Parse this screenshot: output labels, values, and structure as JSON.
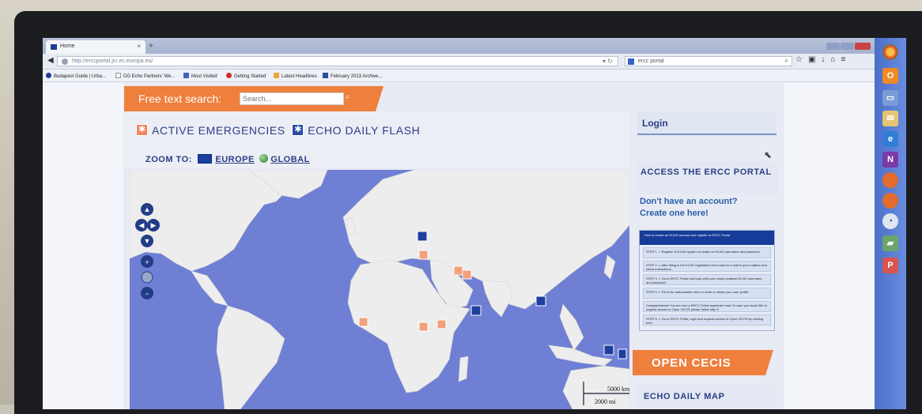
{
  "browser": {
    "tab_title": "Home",
    "tab_close": "×",
    "new_tab": "+",
    "url": "http://erccportal.jrc.ec.europa.eu/",
    "search_value": "ercc portal",
    "bookmarks": [
      "Budapest Guide | Urba...",
      "DG Echo Partners' We...",
      "Most Visited",
      "Getting Started",
      "Latest Headlines",
      "February 2013 Archive..."
    ]
  },
  "page": {
    "free_text_search": {
      "label": "Free text search:",
      "placeholder": "Search..."
    },
    "menu": {
      "active_emergencies": "ACTIVE EMERGENCIES",
      "echo_daily_flash": "ECHO DAILY FLASH"
    },
    "zoom": {
      "label": "ZOOM TO:",
      "europe": "EUROPE",
      "global": "GLOBAL"
    },
    "map": {
      "scale_km": "5000 km",
      "scale_mi": "2000 mi"
    },
    "sidebar": {
      "login": "Login",
      "access_title": "ACCESS THE ERCC PORTAL",
      "no_account_1": "Don't have an account?",
      "no_account_2": "Create one here!",
      "steps_header": "How to create an ECAS account and register to ERCC Portal",
      "steps": [
        "STEP 1 -> Register to ECAS system to obtain an ECAS username and password",
        "STEP 2 -> After filling in the ECAS registration form wait for e-mail in your mailbox and follow instructions.",
        "STEP 3 -> Go to ERCC Portal and login with your newly obtained ECAS username and password",
        "STEP 4 -> Fill in the authorization form in order to obtain your user profile",
        "Congratulations! You are now a ERCC Portal registered user! In case you would like to request access to Open CECIS please follow step 5",
        "STEP 5 -> Go to ERCC Portal, login and request access to Open CECIS by clicking here"
      ],
      "open_cecis": "OPEN CECIS",
      "echo_daily_map": "ECHO DAILY MAP"
    }
  },
  "colors": {
    "accent_orange": "#ef7f3c",
    "brand_blue": "#2a3e86",
    "ocean": "#6f7fd4",
    "land": "#ededed"
  }
}
